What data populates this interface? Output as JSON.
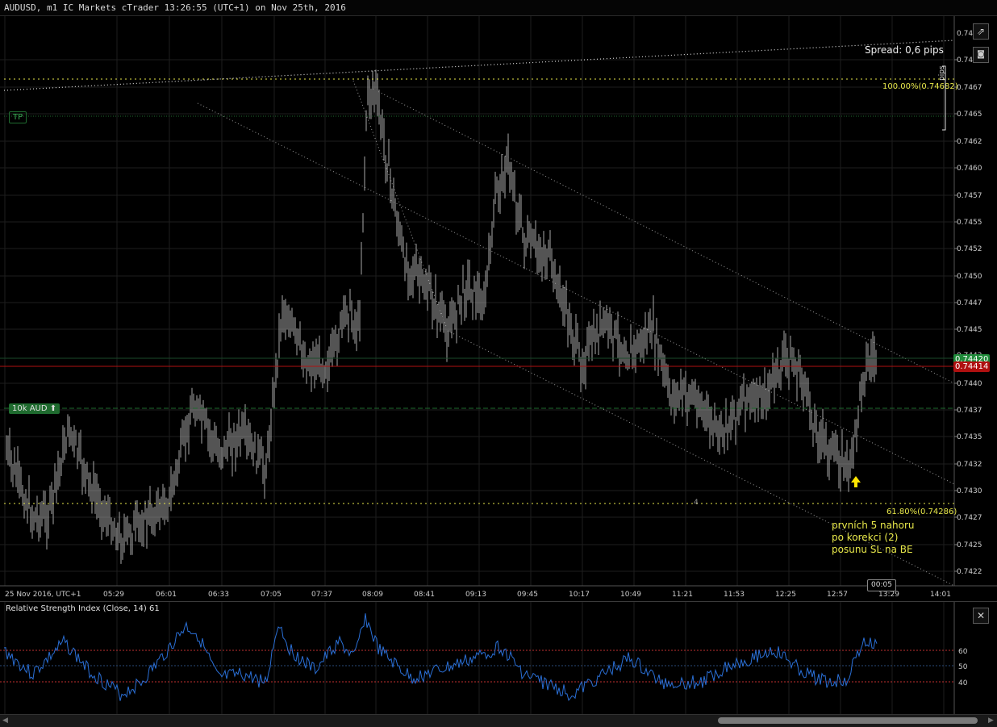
{
  "window": {
    "title": "AUDUSD, m1 IC Markets cTrader 13:26:55 (UTC+1) on Nov 25th, 2016"
  },
  "chart": {
    "spread_label": "Spread: 0,6 pips",
    "pips_label": "pips",
    "tp_label": "TP",
    "position_label": "10k AUD ⬆",
    "fib_100": "100.00%(0.74682)",
    "fib_618": "61.80%(0.74286)",
    "fib_point_label": "4",
    "annotation_lines": [
      "prvních 5 nahoru",
      "po korekci (2)",
      "posunu SL na BE"
    ],
    "current_price_ask": "0.74420",
    "current_price_bid": "0.74414",
    "price_partial": "0.7442",
    "time_remaining": "00:05",
    "price_ticks": [
      "0.7470",
      "0.7467",
      "0.7465",
      "0.7462",
      "0.7460",
      "0.7457",
      "0.7455",
      "0.7452",
      "0.7450",
      "0.7447",
      "0.7445",
      "0.7440",
      "0.7437",
      "0.7435",
      "0.7432",
      "0.7430",
      "0.7427",
      "0.7425",
      "0.7422"
    ],
    "price_tick_top": "0.747",
    "time_ticks": [
      "25 Nov 2016, UTC+1",
      "05:29",
      "06:01",
      "06:33",
      "07:05",
      "07:37",
      "08:09",
      "08:41",
      "09:13",
      "09:45",
      "10:17",
      "10:49",
      "11:21",
      "11:53",
      "12:25",
      "12:57",
      "13:29",
      "14:01"
    ],
    "colors": {
      "grid": "#1e1e1e",
      "candle": "#a8a8a8",
      "fib_yellow": "#e8e84a",
      "ask_green": "#1f8a3a",
      "bid_red": "#b01010",
      "rsi_line": "#2a6fd6"
    }
  },
  "rsi": {
    "title": "Relative Strength Index (Close, 14) 61",
    "levels": [
      "60",
      "50",
      "40"
    ],
    "close_icon": "close-icon"
  },
  "toolbar": {
    "detach_icon": "detach-icon",
    "camera_icon": "camera-icon"
  }
}
